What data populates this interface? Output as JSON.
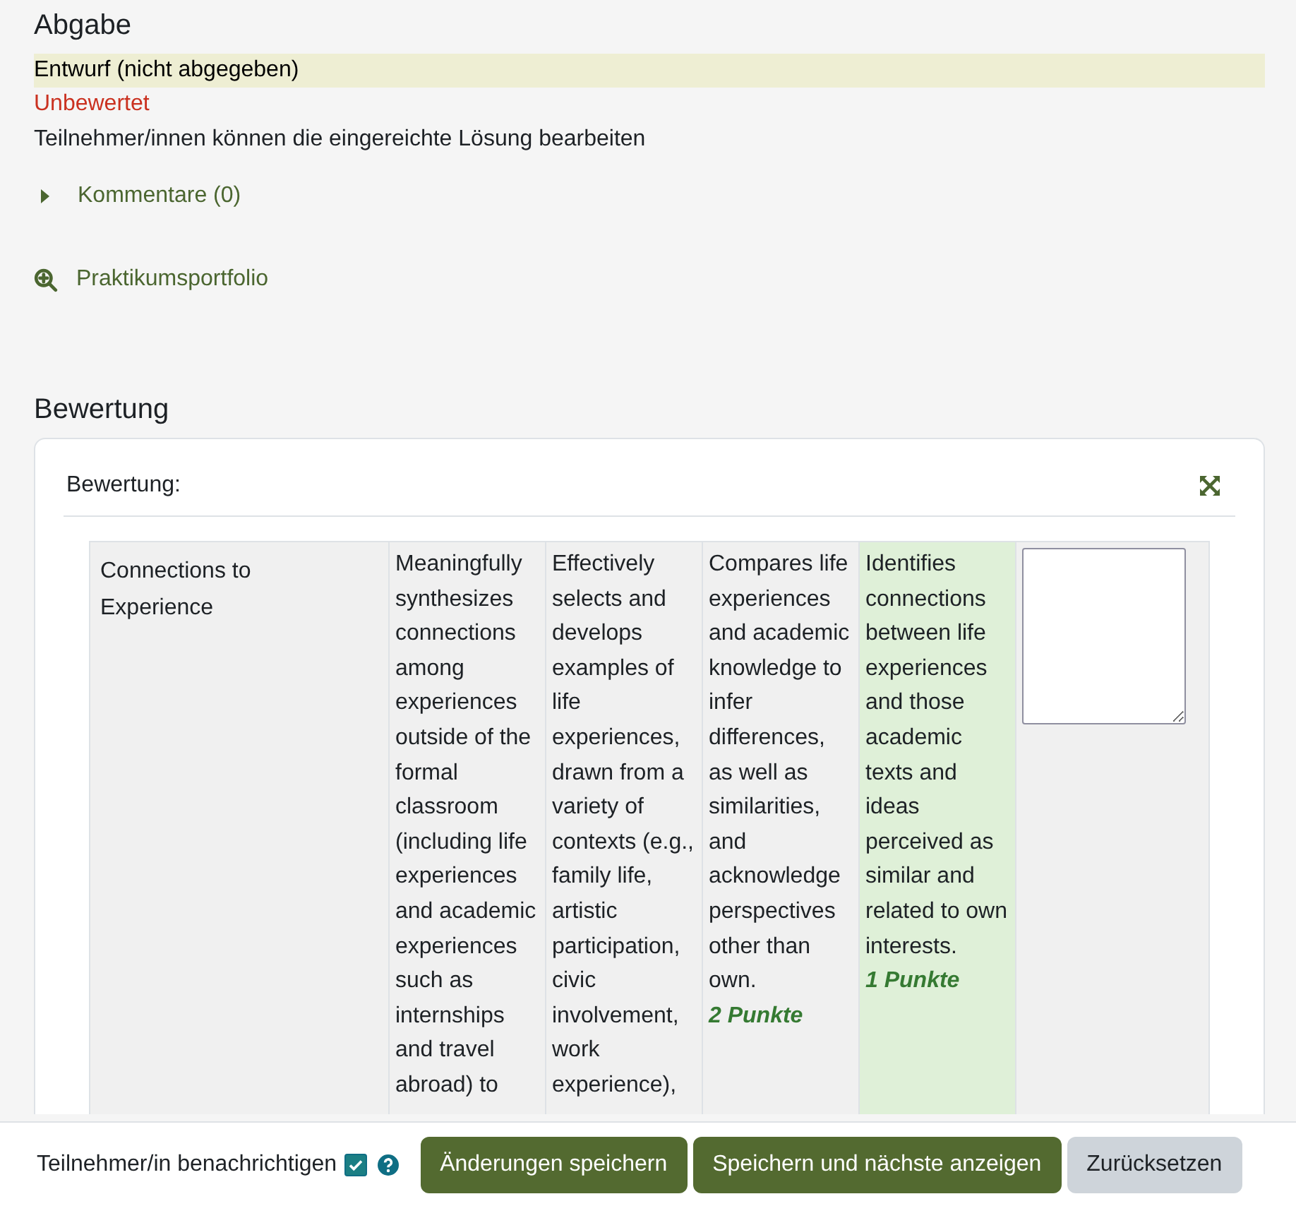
{
  "submission": {
    "heading": "Abgabe",
    "status": "Entwurf (nicht abgegeben)",
    "grading_status": "Unbewertet",
    "note": "Teilnehmer/innen können die eingereichte Lösung bearbeiten",
    "comments": {
      "label": "Kommentare (0)",
      "expanded": false
    },
    "file_link": "Praktikumsportfolio"
  },
  "grading": {
    "heading": "Bewertung",
    "panel_label": "Bewertung:",
    "rubric": {
      "criteria": [
        {
          "description": "Connections to Experience",
          "levels": [
            {
              "definition": "Meaningfully synthesizes connections among experiences outside of the formal classroom (including life experiences and academic experiences such as internships and travel abroad) to",
              "selected": false
            },
            {
              "definition": "Effectively selects and develops examples of life experiences, drawn from a variety of contexts (e.g., family life, artistic participation, civic involvement, work experience),",
              "selected": false
            },
            {
              "definition": "Compares life experiences and academic knowledge to infer differences, as well as similarities, and acknowledge perspectives other than own.",
              "score": "2 Punkte",
              "selected": false
            },
            {
              "definition": "Identifies connections between life experiences and those academic texts and ideas perceived as similar and related to own interests.",
              "score": "1 Punkte",
              "selected": true
            }
          ]
        }
      ]
    }
  },
  "footer": {
    "notify_label": "Teilnehmer/in benachrichtigen",
    "notify_checked": true,
    "buttons": [
      {
        "label": "Änderungen speichern",
        "kind": "primary"
      },
      {
        "label": "Speichern und nächste anzeigen",
        "kind": "primary"
      },
      {
        "label": "Zurücksetzen",
        "kind": "secondary"
      }
    ]
  }
}
